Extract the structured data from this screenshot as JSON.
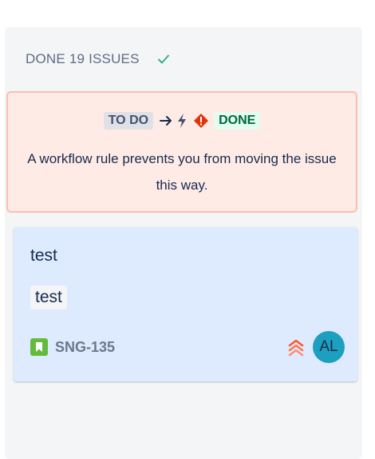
{
  "column": {
    "title": "DONE 19 ISSUES",
    "status_icon": "check-icon"
  },
  "rule_card": {
    "from_status": "TO DO",
    "to_status": "DONE",
    "icons": [
      "arrow-right-icon",
      "lightning-bolt-icon",
      "warning-diamond-icon"
    ],
    "message": "A workflow rule prevents you from moving the issue this way."
  },
  "issue": {
    "summary": "test",
    "label": "test",
    "type_icon": "story-icon",
    "key": "SNG-135",
    "priority_icon": "highest-priority-icon",
    "assignee_initials": "AL"
  },
  "colors": {
    "column_bg": "#f4f5f7",
    "rule_bg": "#ffebe6",
    "rule_border": "#ffbdad",
    "card_bg": "#deebff",
    "avatar_bg": "#1d9fbf",
    "done_green": "#006644",
    "check_green": "#36b37e",
    "priority_red": "#ff5630",
    "story_green": "#63ba3c"
  }
}
